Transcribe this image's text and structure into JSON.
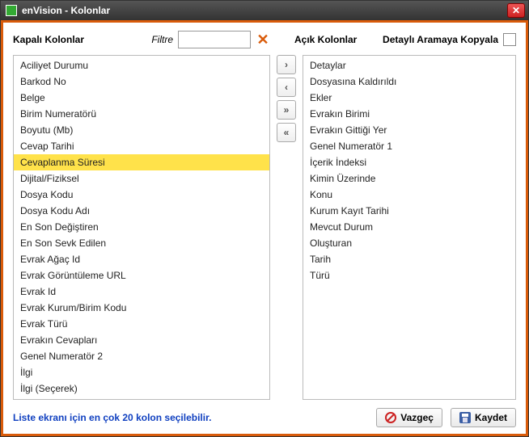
{
  "window": {
    "title": "enVision - Kolonlar"
  },
  "headers": {
    "closed_label": "Kapalı Kolonlar",
    "filter_label": "Filtre",
    "filter_value": "",
    "open_label": "Açık Kolonlar",
    "copy_label": "Detaylı Aramaya Kopyala"
  },
  "closed_columns": [
    "Aciliyet Durumu",
    "Barkod No",
    "Belge",
    "Birim Numeratörü",
    "Boyutu (Mb)",
    "Cevap Tarihi",
    "Cevaplanma Süresi",
    "Dijital/Fiziksel",
    "Dosya Kodu",
    "Dosya Kodu Adı",
    "En Son Değiştiren",
    "En Son Sevk Edilen",
    "Evrak Ağaç Id",
    "Evrak Görüntüleme URL",
    "Evrak Id",
    "Evrak Kurum/Birim Kodu",
    "Evrak Türü",
    "Evrakın Cevapları",
    "Genel Numeratör 2",
    "İlgi",
    "İlgi (Seçerek)"
  ],
  "closed_selected_index": 6,
  "open_columns": [
    "Detaylar",
    "Dosyasına Kaldırıldı",
    "Ekler",
    "Evrakın Birimi",
    "Evrakın Gittiği Yer",
    "Genel Numeratör 1",
    "İçerik İndeksi",
    "Kimin Üzerinde",
    "Konu",
    "Kurum Kayıt Tarihi",
    "Mevcut Durum",
    "Oluşturan",
    "Tarih",
    "Türü"
  ],
  "move_buttons": {
    "right": "›",
    "left": "‹",
    "all_right": "»",
    "all_left": "«"
  },
  "footer": {
    "hint": "Liste ekranı için en çok 20 kolon seçilebilir.",
    "cancel": "Vazgeç",
    "save": "Kaydet"
  }
}
